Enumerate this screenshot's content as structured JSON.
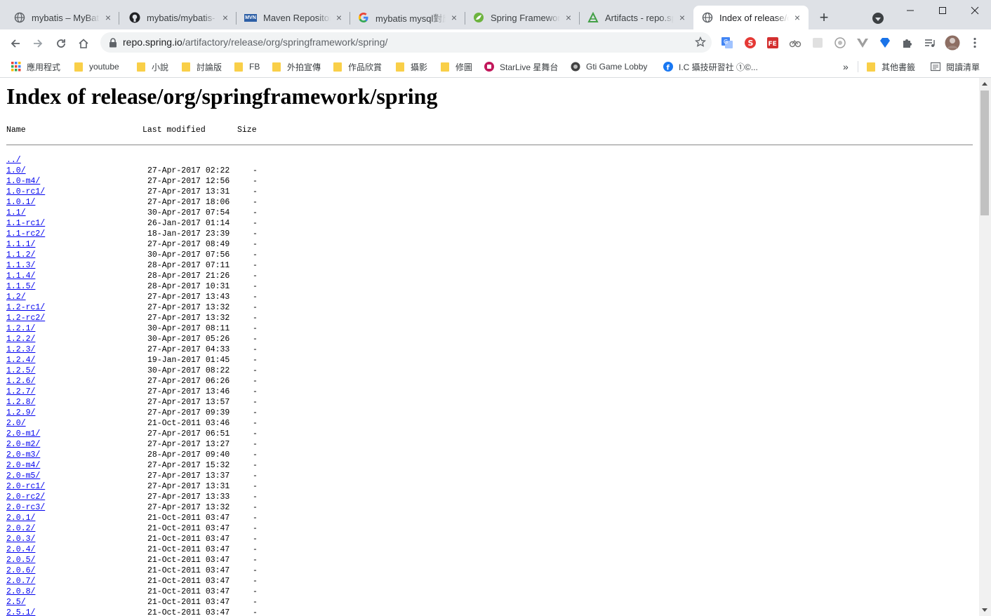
{
  "tabs": [
    {
      "title": "mybatis – MyBatis",
      "icon": "globe-icon",
      "close": "×"
    },
    {
      "title": "mybatis/mybatis-",
      "icon": "github-icon",
      "close": "×"
    },
    {
      "title": "Maven Repository",
      "icon": "mvn-icon",
      "icon_text": "MVN",
      "close": "×"
    },
    {
      "title": "mybatis mysql對應",
      "icon": "google-icon",
      "close": "×"
    },
    {
      "title": "Spring Framework",
      "icon": "spring-icon",
      "close": "×"
    },
    {
      "title": "Artifacts - repo.sp",
      "icon": "artifactory-icon",
      "close": "×"
    },
    {
      "title": "Index of release/o",
      "icon": "globe-icon",
      "close": "×"
    }
  ],
  "new_tab": "+",
  "address": {
    "host": "repo.spring.io",
    "path": "/artifactory/release/org/springframework/spring/"
  },
  "bookmarks": [
    {
      "label": "應用程式",
      "icon": "apps-grid-icon"
    },
    {
      "label": "youtube",
      "icon": "folder-icon"
    },
    {
      "label": "小說",
      "icon": "folder-icon"
    },
    {
      "label": "討論版",
      "icon": "folder-icon"
    },
    {
      "label": "FB",
      "icon": "folder-icon"
    },
    {
      "label": "外拍宣傳",
      "icon": "folder-icon"
    },
    {
      "label": "作品欣賞",
      "icon": "folder-icon"
    },
    {
      "label": "攝影",
      "icon": "folder-icon"
    },
    {
      "label": "修圖",
      "icon": "folder-icon"
    },
    {
      "label": "StarLive 星舞台",
      "icon": "starlive-icon"
    },
    {
      "label": "Gti Game Lobby",
      "icon": "gti-icon"
    },
    {
      "label": "I.C 攝技研習社 ①©...",
      "icon": "facebook-icon"
    }
  ],
  "bookmarks_overflow": "»",
  "other_bookmarks": "其他書籤",
  "reading_list": "閱讀清單",
  "page": {
    "title": "Index of release/org/springframework/spring",
    "columns": {
      "name": "Name",
      "modified": "Last modified",
      "size": "Size"
    },
    "parent": "../",
    "entries": [
      {
        "name": "1.0/",
        "modified": "27-Apr-2017 02:22",
        "size": "-"
      },
      {
        "name": "1.0-m4/",
        "modified": "27-Apr-2017 12:56",
        "size": "-"
      },
      {
        "name": "1.0-rc1/",
        "modified": "27-Apr-2017 13:31",
        "size": "-"
      },
      {
        "name": "1.0.1/",
        "modified": "27-Apr-2017 18:06",
        "size": "-"
      },
      {
        "name": "1.1/",
        "modified": "30-Apr-2017 07:54",
        "size": "-"
      },
      {
        "name": "1.1-rc1/",
        "modified": "26-Jan-2017 01:14",
        "size": "-"
      },
      {
        "name": "1.1-rc2/",
        "modified": "18-Jan-2017 23:39",
        "size": "-"
      },
      {
        "name": "1.1.1/",
        "modified": "27-Apr-2017 08:49",
        "size": "-"
      },
      {
        "name": "1.1.2/",
        "modified": "30-Apr-2017 07:56",
        "size": "-"
      },
      {
        "name": "1.1.3/",
        "modified": "28-Apr-2017 07:11",
        "size": "-"
      },
      {
        "name": "1.1.4/",
        "modified": "28-Apr-2017 21:26",
        "size": "-"
      },
      {
        "name": "1.1.5/",
        "modified": "28-Apr-2017 10:31",
        "size": "-"
      },
      {
        "name": "1.2/",
        "modified": "27-Apr-2017 13:43",
        "size": "-"
      },
      {
        "name": "1.2-rc1/",
        "modified": "27-Apr-2017 13:32",
        "size": "-"
      },
      {
        "name": "1.2-rc2/",
        "modified": "27-Apr-2017 13:32",
        "size": "-"
      },
      {
        "name": "1.2.1/",
        "modified": "30-Apr-2017 08:11",
        "size": "-"
      },
      {
        "name": "1.2.2/",
        "modified": "30-Apr-2017 05:26",
        "size": "-"
      },
      {
        "name": "1.2.3/",
        "modified": "27-Apr-2017 04:33",
        "size": "-"
      },
      {
        "name": "1.2.4/",
        "modified": "19-Jan-2017 01:45",
        "size": "-"
      },
      {
        "name": "1.2.5/",
        "modified": "30-Apr-2017 08:22",
        "size": "-"
      },
      {
        "name": "1.2.6/",
        "modified": "27-Apr-2017 06:26",
        "size": "-"
      },
      {
        "name": "1.2.7/",
        "modified": "27-Apr-2017 13:46",
        "size": "-"
      },
      {
        "name": "1.2.8/",
        "modified": "27-Apr-2017 13:57",
        "size": "-"
      },
      {
        "name": "1.2.9/",
        "modified": "27-Apr-2017 09:39",
        "size": "-"
      },
      {
        "name": "2.0/",
        "modified": "21-Oct-2011 03:46",
        "size": "-"
      },
      {
        "name": "2.0-m1/",
        "modified": "27-Apr-2017 06:51",
        "size": "-"
      },
      {
        "name": "2.0-m2/",
        "modified": "27-Apr-2017 13:27",
        "size": "-"
      },
      {
        "name": "2.0-m3/",
        "modified": "28-Apr-2017 09:40",
        "size": "-"
      },
      {
        "name": "2.0-m4/",
        "modified": "27-Apr-2017 15:32",
        "size": "-"
      },
      {
        "name": "2.0-m5/",
        "modified": "27-Apr-2017 13:37",
        "size": "-"
      },
      {
        "name": "2.0-rc1/",
        "modified": "27-Apr-2017 13:31",
        "size": "-"
      },
      {
        "name": "2.0-rc2/",
        "modified": "27-Apr-2017 13:33",
        "size": "-"
      },
      {
        "name": "2.0-rc3/",
        "modified": "27-Apr-2017 13:32",
        "size": "-"
      },
      {
        "name": "2.0.1/",
        "modified": "21-Oct-2011 03:47",
        "size": "-"
      },
      {
        "name": "2.0.2/",
        "modified": "21-Oct-2011 03:47",
        "size": "-"
      },
      {
        "name": "2.0.3/",
        "modified": "21-Oct-2011 03:47",
        "size": "-"
      },
      {
        "name": "2.0.4/",
        "modified": "21-Oct-2011 03:47",
        "size": "-"
      },
      {
        "name": "2.0.5/",
        "modified": "21-Oct-2011 03:47",
        "size": "-"
      },
      {
        "name": "2.0.6/",
        "modified": "21-Oct-2011 03:47",
        "size": "-"
      },
      {
        "name": "2.0.7/",
        "modified": "21-Oct-2011 03:47",
        "size": "-"
      },
      {
        "name": "2.0.8/",
        "modified": "21-Oct-2011 03:47",
        "size": "-"
      },
      {
        "name": "2.5/",
        "modified": "21-Oct-2011 03:47",
        "size": "-"
      },
      {
        "name": "2.5.1/",
        "modified": "21-Oct-2011 03:47",
        "size": "-"
      }
    ]
  },
  "colors": {
    "link": "#0000ee",
    "tabstrip": "#dee1e6",
    "omnibox": "#f1f3f4"
  }
}
